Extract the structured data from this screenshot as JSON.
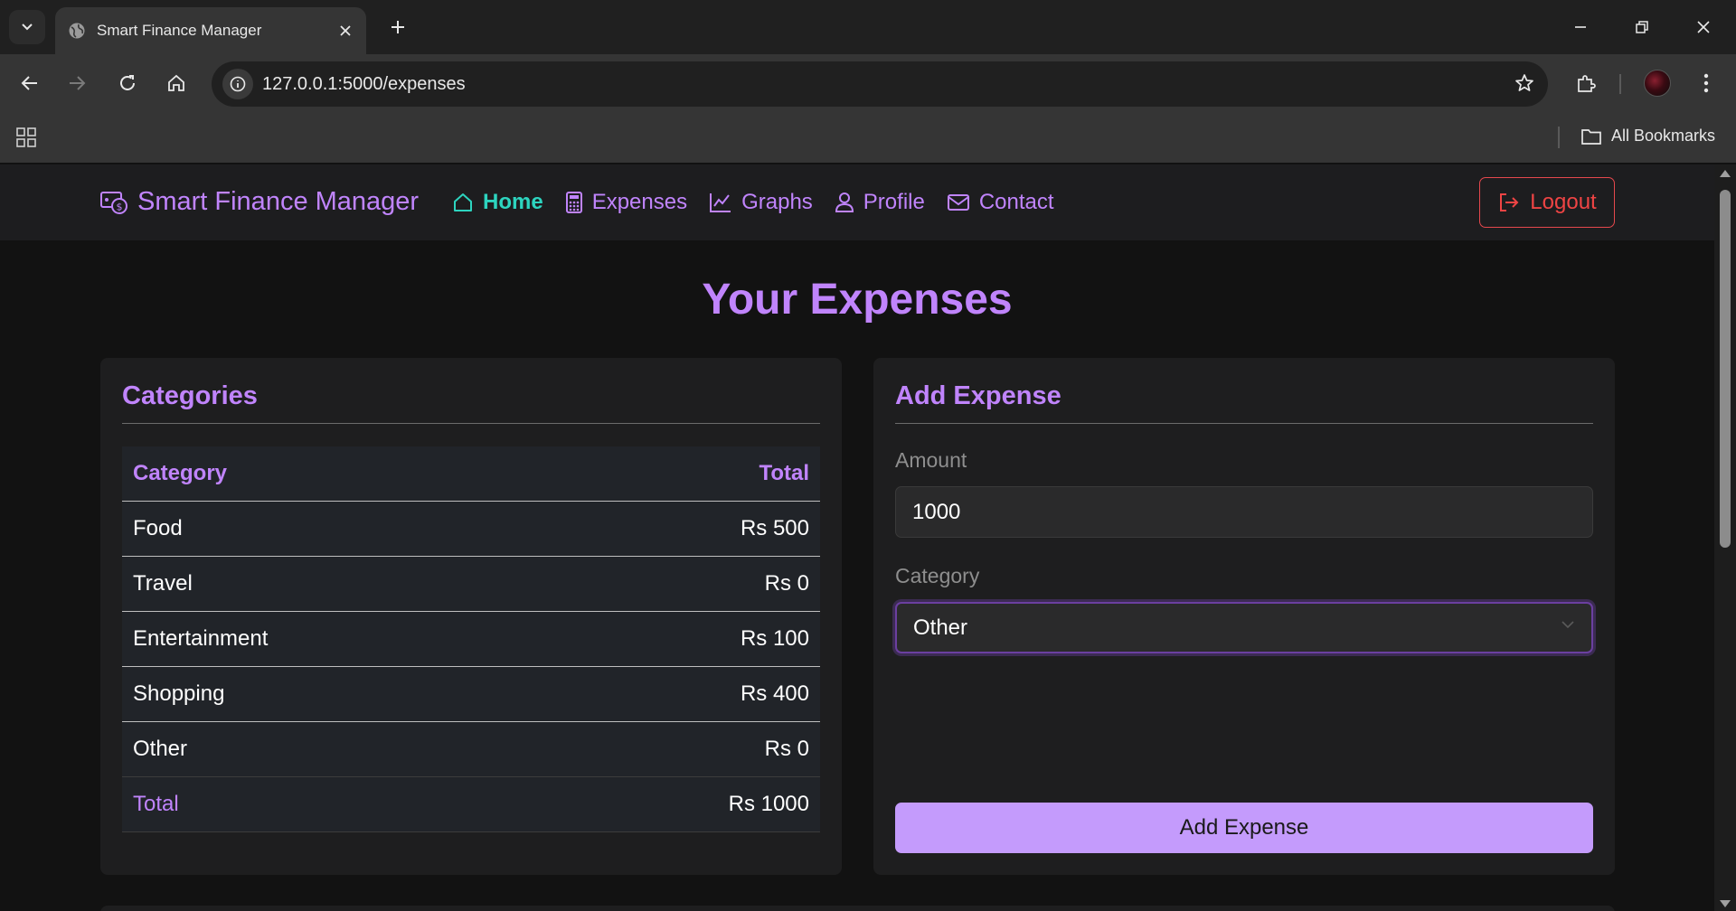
{
  "browser": {
    "tab_title": "Smart Finance Manager",
    "url": "127.0.0.1:5000/expenses",
    "bookmarks_label": "All Bookmarks"
  },
  "navbar": {
    "brand": "Smart Finance Manager",
    "links": [
      {
        "label": "Home",
        "icon": "home-icon",
        "active": true
      },
      {
        "label": "Expenses",
        "icon": "calculator-icon"
      },
      {
        "label": "Graphs",
        "icon": "chart-line-icon"
      },
      {
        "label": "Profile",
        "icon": "person-icon"
      },
      {
        "label": "Contact",
        "icon": "envelope-icon"
      }
    ],
    "logout": "Logout"
  },
  "page": {
    "title": "Your Expenses"
  },
  "categories": {
    "title": "Categories",
    "headers": {
      "category": "Category",
      "total": "Total"
    },
    "rows": [
      {
        "category": "Food",
        "total": "Rs 500"
      },
      {
        "category": "Travel",
        "total": "Rs 0"
      },
      {
        "category": "Entertainment",
        "total": "Rs 100"
      },
      {
        "category": "Shopping",
        "total": "Rs 400"
      },
      {
        "category": "Other",
        "total": "Rs 0"
      }
    ],
    "total_row": {
      "label": "Total",
      "value": "Rs 1000"
    }
  },
  "add_expense": {
    "title": "Add Expense",
    "amount_label": "Amount",
    "amount_value": "1000",
    "category_label": "Category",
    "category_value": "Other",
    "submit_label": "Add Expense"
  },
  "colors": {
    "accent": "#c084fc",
    "active_link": "#2dd4bf",
    "logout": "#ef4444",
    "button_bg": "#c49bfc"
  }
}
